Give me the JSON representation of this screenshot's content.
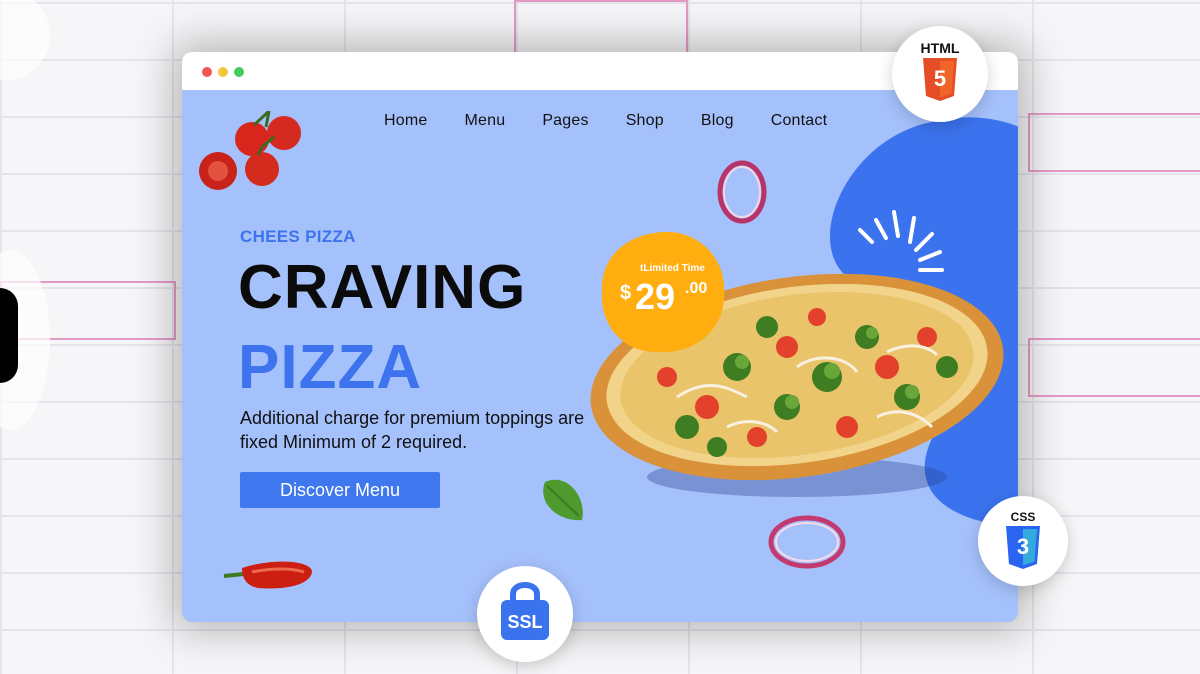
{
  "nav": {
    "items": [
      "Home",
      "Menu",
      "Pages",
      "Shop",
      "Blog",
      "Contact"
    ]
  },
  "hero": {
    "eyebrow": "CHEES PIZZA",
    "headline_line1": "CRAVING",
    "headline_line2": "PIZZA",
    "description": "Additional charge for premium toppings are fixed Minimum of 2 required.",
    "cta_label": "Discover Menu"
  },
  "price_badge": {
    "label": "tLimited Time",
    "currency": "$",
    "amount": "29",
    "cents": ".00"
  },
  "tech_badges": {
    "html_label": "HTML",
    "html_number": "5",
    "css_label": "CSS",
    "css_number": "3",
    "ssl_label": "SSL"
  },
  "icons": [
    "tomato-icon",
    "onion-ring-icon",
    "basil-leaf-icon",
    "chili-pepper-icon",
    "html5-icon",
    "css3-icon",
    "ssl-lock-icon"
  ],
  "colors": {
    "page_bg": "#a5c1fb",
    "accent_blue": "#3d74ee",
    "blob_blue": "#3b73ee",
    "badge_orange": "#ffad0f",
    "html_orange": "#e44d26",
    "css_blue": "#2965f1"
  }
}
